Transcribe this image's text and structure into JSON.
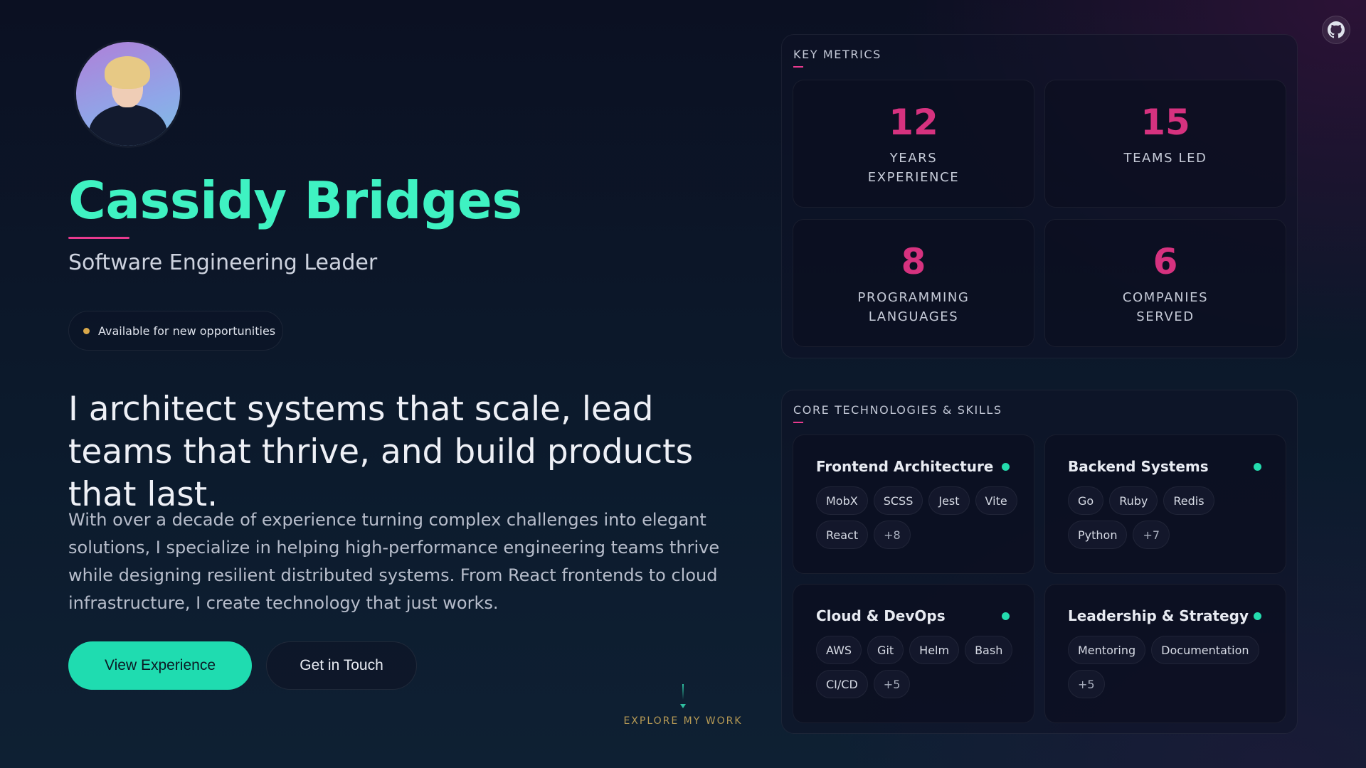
{
  "profile": {
    "name": "Cassidy Bridges",
    "role": "Software Engineering Leader",
    "status": "Available for new opportunities",
    "headline": "I architect systems that scale, lead teams that thrive, and build products that last.",
    "bio": "With over a decade of experience turning complex challenges into elegant solutions, I specialize in helping high-performance engineering teams thrive while designing resilient distributed systems. From React frontends to cloud infrastructure, I create technology that just works."
  },
  "actions": {
    "primary": "View Experience",
    "secondary": "Get in Touch",
    "explore": "EXPLORE MY WORK"
  },
  "icons": {
    "top_right": "github-icon"
  },
  "metrics": {
    "title": "KEY METRICS",
    "items": [
      {
        "value": "12",
        "label": "YEARS EXPERIENCE"
      },
      {
        "value": "15",
        "label": "TEAMS LED"
      },
      {
        "value": "8",
        "label": "PROGRAMMING LANGUAGES"
      },
      {
        "value": "6",
        "label": "COMPANIES SERVED"
      }
    ]
  },
  "skills": {
    "title": "CORE TECHNOLOGIES & SKILLS",
    "groups": [
      {
        "title": "Frontend Architecture",
        "tags": [
          "MobX",
          "SCSS",
          "Jest",
          "Vite",
          "React"
        ],
        "more": "+8"
      },
      {
        "title": "Backend Systems",
        "tags": [
          "Go",
          "Ruby",
          "Redis",
          "Python"
        ],
        "more": "+7"
      },
      {
        "title": "Cloud & DevOps",
        "tags": [
          "AWS",
          "Git",
          "Helm",
          "Bash",
          "CI/CD"
        ],
        "more": "+5"
      },
      {
        "title": "Leadership & Strategy",
        "tags": [
          "Mentoring",
          "Documentation"
        ],
        "more": "+5"
      }
    ]
  },
  "colors": {
    "accent": "#3ff2c2",
    "button": "#1fdcb0",
    "metric_value": "#d6327f",
    "underline": "#e83a8e",
    "status_dot": "#d9a84a",
    "skill_dot": "#24dcae"
  }
}
